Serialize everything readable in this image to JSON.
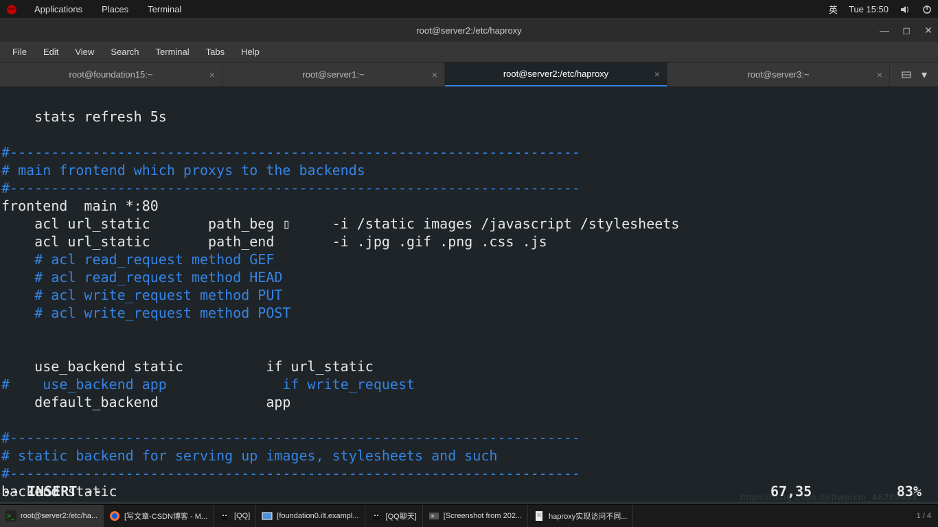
{
  "topbar": {
    "apps": "Applications",
    "places": "Places",
    "terminal": "Terminal",
    "lang": "英",
    "clock": "Tue 15:50"
  },
  "window": {
    "title": "root@server2:/etc/haproxy"
  },
  "menu": {
    "file": "File",
    "edit": "Edit",
    "view": "View",
    "search": "Search",
    "terminal": "Terminal",
    "tabs": "Tabs",
    "help": "Help"
  },
  "tabs": {
    "t0": "root@foundation15:~",
    "t1": "root@server1:~",
    "t2": "root@server2:/etc/haproxy",
    "t3": "root@server3:~"
  },
  "term": {
    "l01": "    stats refresh 5s",
    "l02": "",
    "l03": "#---------------------------------------------------------------------",
    "l04": "# main frontend which proxys to the backends",
    "l05": "#---------------------------------------------------------------------",
    "l06": "frontend  main *:80",
    "l07": "    acl url_static       path_beg ▯     -i /static images /javascript /stylesheets",
    "l08": "    acl url_static       path_end       -i .jpg .gif .png .css .js",
    "l09": "    # acl read_request method GEF",
    "l10": "    # acl read_request method HEAD",
    "l11": "    # acl write_request method PUT",
    "l12": "    # acl write_request method POST",
    "l13": "",
    "l14": "",
    "l15": "    use_backend static          if url_static",
    "l16a": "#",
    "l16b": "    use_backend app             ",
    "l16c": " if write_request",
    "l17": "    default_backend             app",
    "l18": "",
    "l19": "#---------------------------------------------------------------------",
    "l20": "# static backend for serving up images, stylesheets and such",
    "l21": "#---------------------------------------------------------------------",
    "l22": "backend static"
  },
  "vim": {
    "mode": "-- INSERT --",
    "pos": "67,35",
    "pct": "83%"
  },
  "taskbar": {
    "t0": "root@server2:/etc/ha...",
    "t1": "[写文章-CSDN博客 - M...",
    "t2": "[QQ]",
    "t3": "[foundation0.ilt.exampl...",
    "t4": "[QQ聊天]",
    "t5": "[Screenshot from 202...",
    "t6": "haproxy实现访问不同...",
    "pager": "1 / 4"
  },
  "watermark": "https://blog.csdn.net/weixin_46289303"
}
